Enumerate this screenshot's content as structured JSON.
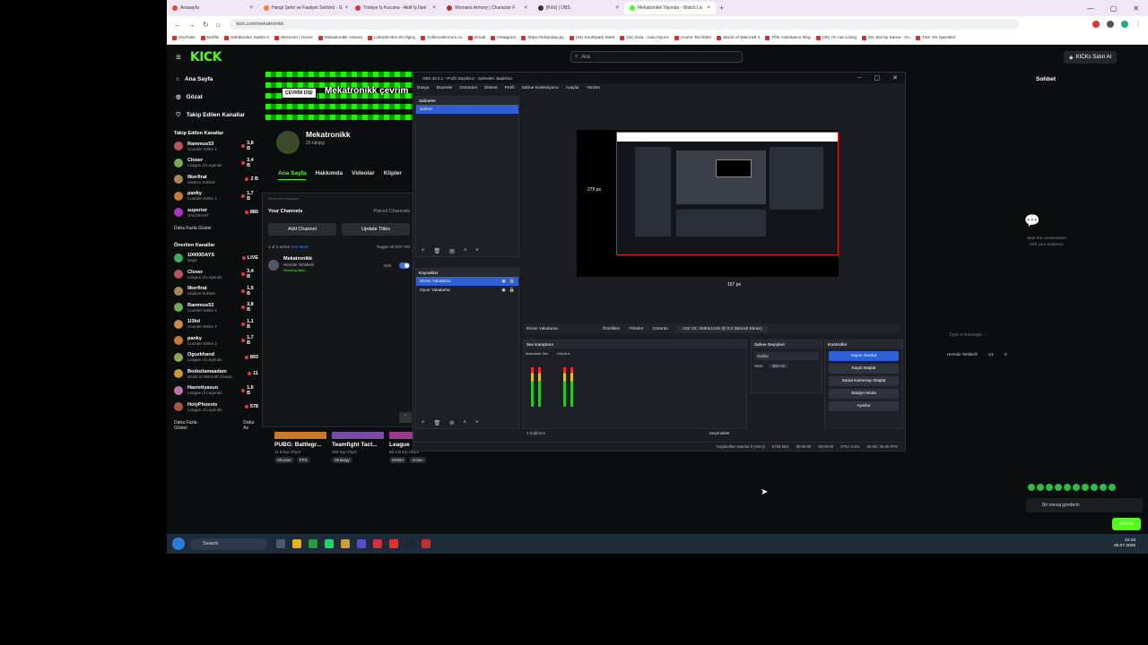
{
  "browser": {
    "tabs": [
      {
        "label": "Anasayfa",
        "active": false
      },
      {
        "label": "Hangi Şehir ve Faaliyet Sektörü - G",
        "active": false
      },
      {
        "label": "Türkiye İş Kurumu - Aktif İş İlanl",
        "active": false
      },
      {
        "label": "Womans Armory | Character F",
        "active": false
      },
      {
        "label": "[Kick] | OBS",
        "active": false
      },
      {
        "label": "Mekatronikk Yayında - Watch Liv",
        "active": true
      }
    ],
    "url": "kick.com/mekatronikk",
    "bookmarks": [
      "YouTube",
      "Netflix",
      "Sahibinden Satılık K",
      "Mertcem | Home",
      "Mekatronikk Ankara",
      "Linkedin'den En İlginç",
      "hollimcelimcom.co",
      "Gmail",
      "Instagram",
      "https://sdarnday.py",
      "(34) Southpark Mark",
      "(11) Zula - Aula Oyunc",
      "Anime Tercihleri",
      "World of Warcraft 3",
      "Tfile Assistance Reg",
      "(30) I'm not a king",
      "ZS: Bot by Kama - Gu",
      "Tüm Yer İşaretleri"
    ]
  },
  "kick": {
    "search_placeholder": "Ara",
    "ai_button": "KICKs Satın Al",
    "nav": [
      {
        "label": "Ana Sayfa",
        "icon": "home-icon"
      },
      {
        "label": "Gözat",
        "icon": "compass-icon"
      },
      {
        "label": "Takip Edilen Kanallar",
        "icon": "heart-icon"
      }
    ],
    "followed_title": "Takip Edilen Kanallar",
    "followed": [
      {
        "name": "Rammus53",
        "game": "Counter-Strike 2",
        "viewers": "3,8 B"
      },
      {
        "name": "Closer",
        "game": "League of Legends",
        "viewers": "3,4 B"
      },
      {
        "name": "Ilkerfirat",
        "game": "Sadece Sohbet",
        "viewers": "2 B"
      },
      {
        "name": "panky",
        "game": "Counter-Strike 2",
        "viewers": "1,7 B"
      },
      {
        "name": "superior",
        "game": "VALORANT",
        "viewers": "880"
      }
    ],
    "show_more": "Daha Fazla Göster",
    "recommended_title": "Önerilen Kanallar",
    "recommended": [
      {
        "name": "10000DAYS",
        "game": "DayZ",
        "viewers": "LIVE"
      },
      {
        "name": "Closer",
        "game": "League of Legends",
        "viewers": "3,4 B"
      },
      {
        "name": "Ilkerfirat",
        "game": "Sadece Sohbet",
        "viewers": "1,9 B"
      },
      {
        "name": "Rammus53",
        "game": "Counter-Strike 2",
        "viewers": "3,8 B"
      },
      {
        "name": "1l3lol",
        "game": "Counter-Strike 2",
        "viewers": "1,1 B"
      },
      {
        "name": "panky",
        "game": "Counter-Strike 2",
        "viewers": "1,7 B"
      },
      {
        "name": "Oguzkhand",
        "game": "League of Legends",
        "viewers": "893"
      },
      {
        "name": "Bodozlamaadam",
        "game": "World of Warcraft Classic",
        "viewers": "11"
      },
      {
        "name": "Hazretiyasuo",
        "game": "League of Legends",
        "viewers": "1,6 B"
      },
      {
        "name": "HolyPhoenix",
        "game": "League of Legends",
        "viewers": "578"
      }
    ],
    "show_more_2": "Daha Fazla Göster",
    "show_more_3": "Daha Az",
    "channel": {
      "offline_badge": "ÇEVRİM DIŞI",
      "banner_title": "Mekatronikk çevrim",
      "name": "Mekatronikk",
      "followers": "20 takipçi",
      "tabs": [
        "Ana Sayfa",
        "Hakkımda",
        "Videolar",
        "Klipler"
      ]
    },
    "categories": [
      {
        "title": "PUBG: Battlegr...",
        "viewers": "11 B kişi izliyor",
        "tags": [
          "Shooter",
          "FPS"
        ]
      },
      {
        "title": "Teamfight Tact...",
        "viewers": "269 kişi izliyor",
        "tags": [
          "Strategy"
        ]
      },
      {
        "title": "League",
        "viewers": "59,3 B kişi izliyor",
        "tags": [
          "MOBA",
          "Action"
        ]
      }
    ],
    "chat": {
      "title": "Sohbet",
      "empty_line1": "Start the conversation",
      "empty_line2": "with your audience",
      "input_placeholder": "Type a message...",
      "footer_name": "Hemide Tehlikelil",
      "footer_count": "1/1",
      "footer_zero": "0"
    },
    "message_placeholder": "Bir mesaj gönderin",
    "send_label": "Gönder"
  },
  "restream": {
    "header": "Restream Kanalları",
    "your_channels": "Your Channels",
    "paired": "Paired Channels",
    "add_channel": "Add Channel",
    "update_titles": "Update Titles",
    "active_text": "1 of 2 active",
    "see_more": "See More",
    "toggle_all": "Toggle all",
    "off": "OFF",
    "on": "ON",
    "channel_name": "Mekatronikk",
    "channel_title": "Hemide Tehlikelil",
    "channel_status": "Sending data...",
    "edit": "Edit"
  },
  "obs": {
    "title": "OBS 32.0.1 - Profil: Başlıksız - Sahneler: Başlıksız",
    "menu": [
      "Dosya",
      "Düzenle",
      "Görünüm",
      "Eklenti",
      "Profil",
      "Sahne Koleksiyonu",
      "Araçlar",
      "Yardım"
    ],
    "scenes_title": "Sahneler",
    "scene": "Sahne",
    "sources_title": "Kaynaklar",
    "sources": [
      {
        "label": "Ekran Yakalama",
        "selected": true
      },
      {
        "label": "Oyun Yakalama",
        "selected": false
      }
    ],
    "dim_left": "279 px",
    "dim_bottom": "157 px",
    "props": "Özellikler",
    "filters": "Filtreler",
    "display": "Görüntü",
    "display_value": "A32 V2: 2560x1440 @ 0,0 (Birincil Ekran)",
    "source_name": "Ekran Yakalama",
    "mixer_title": "Ses Karıştırıcı",
    "mixer_channels": [
      "Masaüstü Ses",
      "Mic/Aux"
    ],
    "trans_title": "Sahne Geçişleri",
    "trans_value": "Soldur",
    "duration_label": "Süre",
    "duration_value": "300 ms",
    "controls_title": "Kontroller",
    "controls": [
      "Yayını Durdur",
      "Kaydı Başlat",
      "Sanal Kamerayı Başlat",
      "Stüdyo Modu",
      "Ayarlar"
    ],
    "selections": "Seçenekler",
    "connected": "0 bağlandı",
    "status": {
      "dropped": "Kaybedilen Kareler 0 (%0.0)",
      "kbps": "5728 kb/s",
      "live_time": "00:00:08",
      "rec_time": "00:00:00",
      "cpu": "CPU: 0.4%",
      "fps": "30.00 / 30.00 FPS"
    }
  },
  "taskbar": {
    "search": "Search",
    "time": "22:19",
    "date": "26.07.2025"
  }
}
